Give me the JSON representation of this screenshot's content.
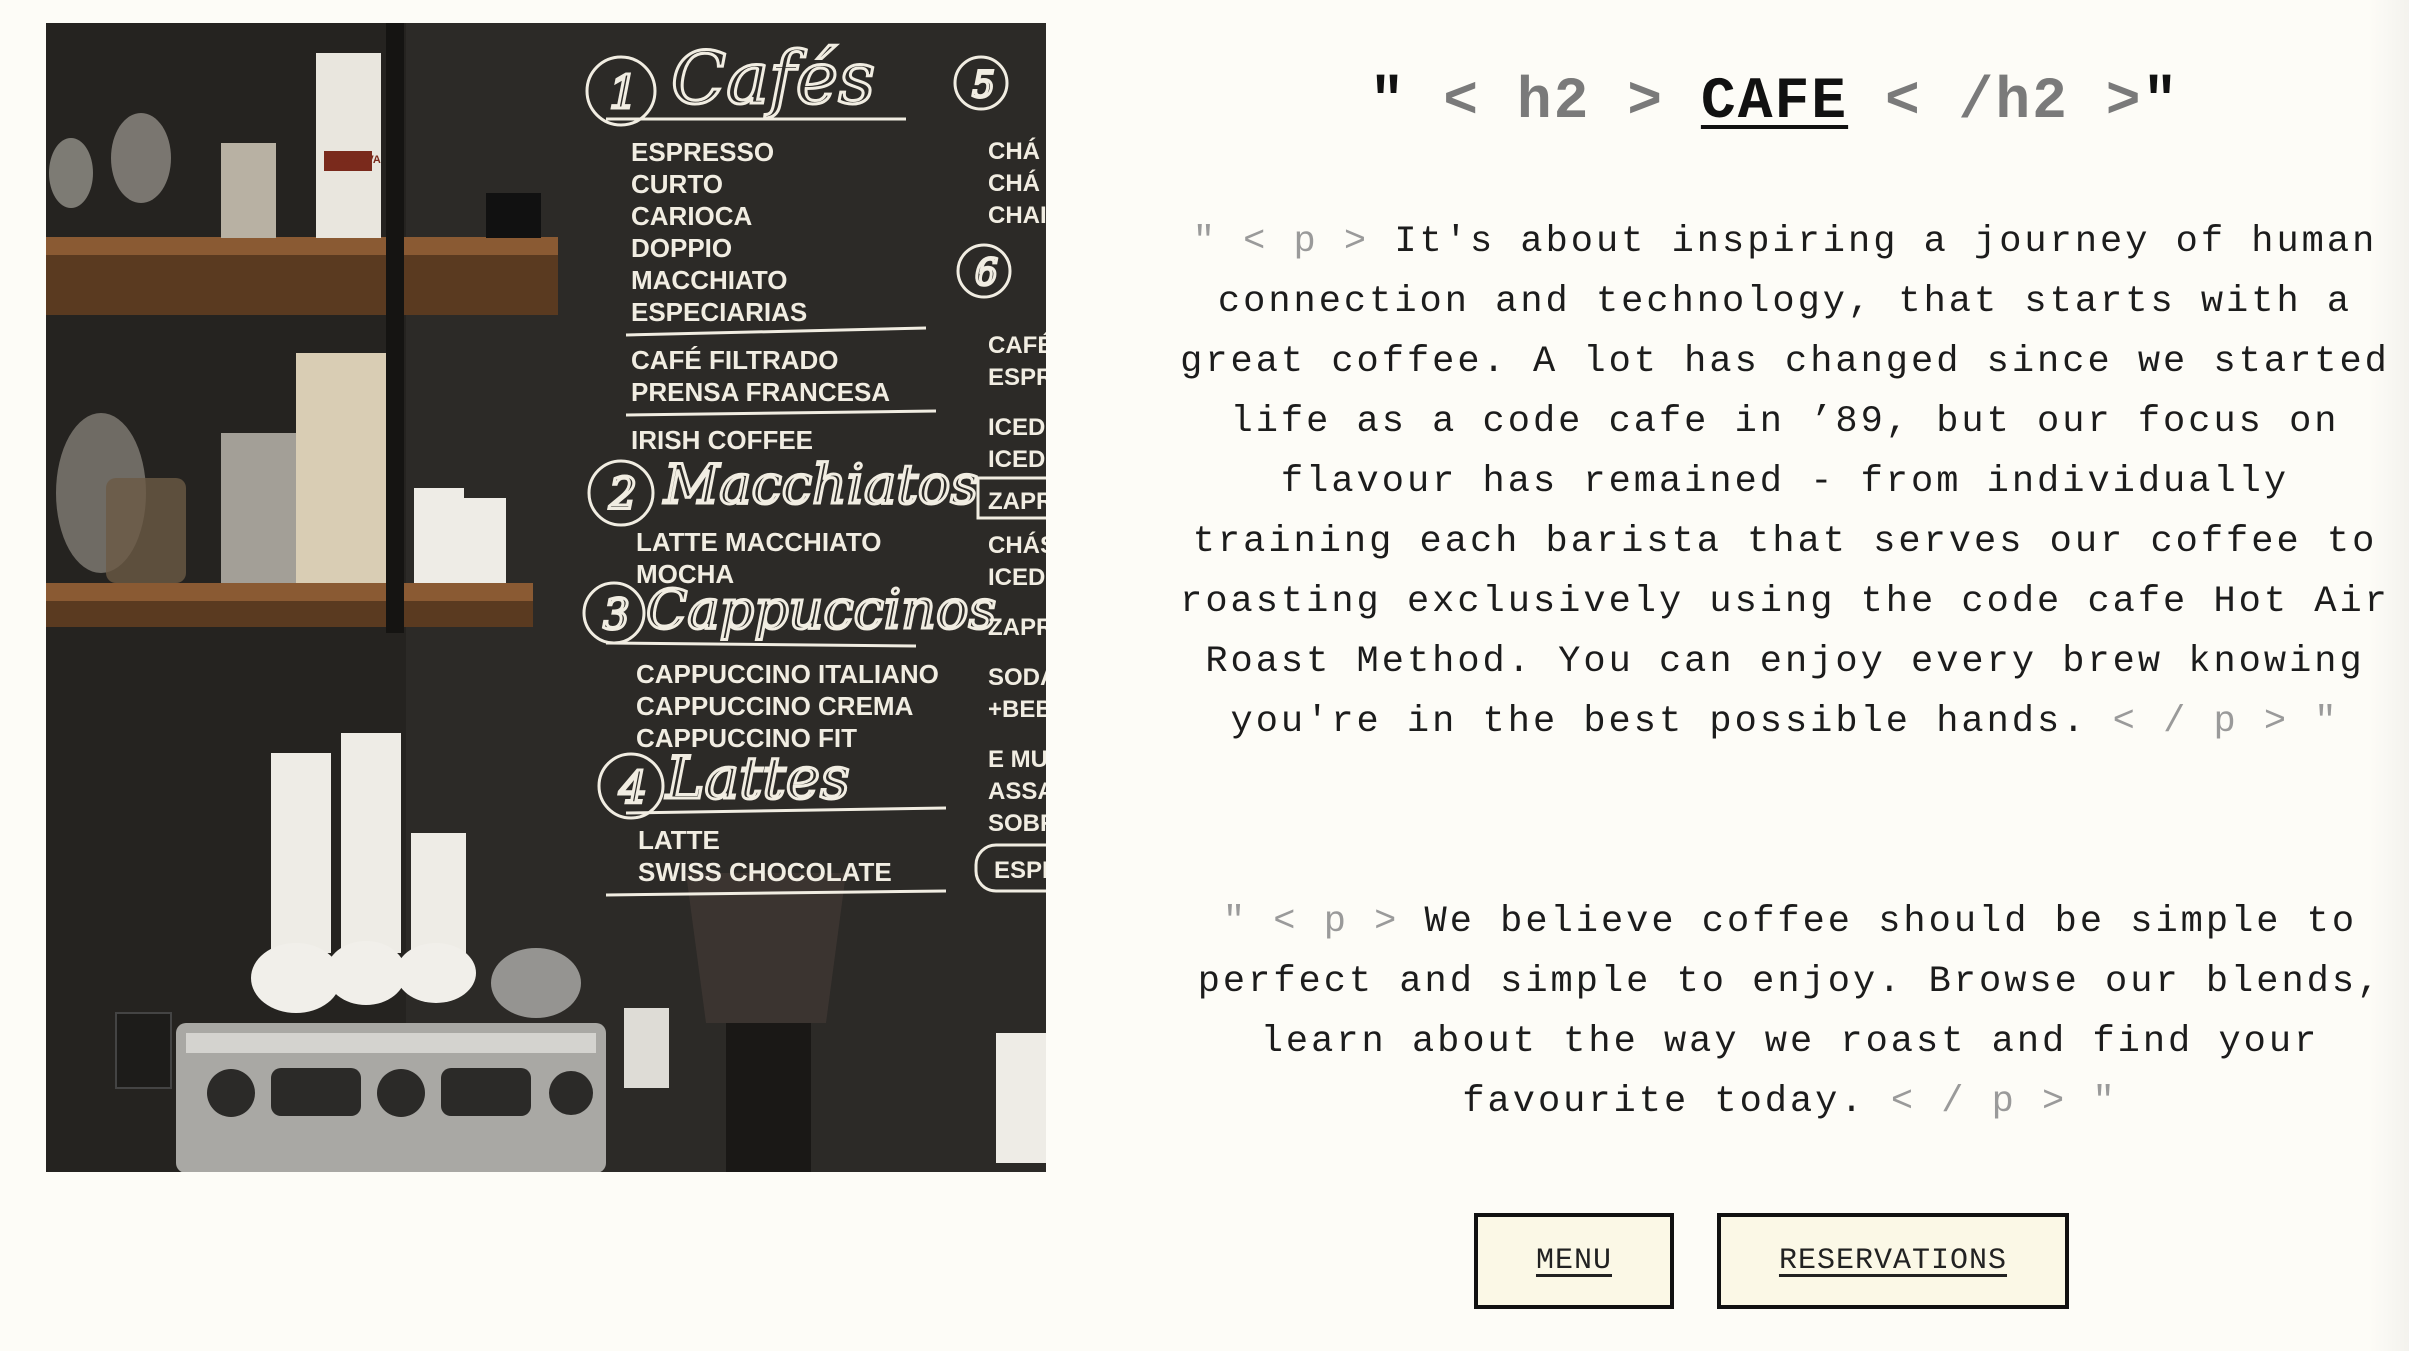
{
  "section": {
    "heading": {
      "open_quote": "\"",
      "open_tag": "< h2 >",
      "title": "CAFE",
      "close_tag": "< /h2 >",
      "close_quote": "\""
    },
    "paragraphs": [
      {
        "open": "\" < p >",
        "text": "It's about inspiring a journey of human connection and technology, that starts with a great coffee. A lot has changed since we started life as a code cafe in ’89, but our focus on flavour has remained - from individually training each barista that serves our coffee to roasting exclusively using the code cafe Hot Air Roast Method. You can enjoy every brew knowing you're in the best possible hands.",
        "close": "< / p > \""
      },
      {
        "open": "\" < p >",
        "text": "We believe coffee should be simple to perfect and simple to enjoy. Browse our blends, learn about the way we roast and find your favourite today.",
        "close": "< / p > \""
      }
    ],
    "buttons": {
      "menu": "MENU",
      "reservations": "RESERVATIONS"
    }
  },
  "photo": {
    "menu_board": {
      "sections": [
        {
          "number": "1",
          "title": "Cafés",
          "items": [
            "ESPRESSO",
            "CURTO",
            "CARIOCA",
            "DOPPIO",
            "MACCHIATO",
            "ESPECIARIAS",
            "CAFÉ FILTRADO",
            "PRENSA FRANCESA",
            "IRISH COFFEE"
          ]
        },
        {
          "number": "2",
          "title": "Macchiatos",
          "items": [
            "LATTE MACCHIATO",
            "MOCHA"
          ]
        },
        {
          "number": "3",
          "title": "Cappuccinos",
          "items": [
            "CAPPUCCINO ITALIANO",
            "CAPPUCCINO CREMA",
            "CAPPUCCINO FIT"
          ]
        },
        {
          "number": "4",
          "title": "Lattes",
          "items": [
            "LATTE",
            "SWISS CHOCOLATE"
          ]
        }
      ],
      "right_column": [
        "CHÁ M",
        "CHÁ B",
        "CHAI",
        "CAFÉ",
        "ESPR",
        "ICED",
        "ICED",
        "ZAPR",
        "CHÁS",
        "ICED",
        "ZAPR",
        "SODA",
        "+BEB",
        "E MU",
        "ASSA",
        "SOBR",
        "ESPE"
      ],
      "right_numbers": [
        "5",
        "6"
      ]
    },
    "package_label": "PRONOVA"
  },
  "colors": {
    "background": "#fdfcf7",
    "button_fill": "#fbf8e6",
    "chalkboard": "#2b2926",
    "tag_gray": "#9a9a9a"
  }
}
